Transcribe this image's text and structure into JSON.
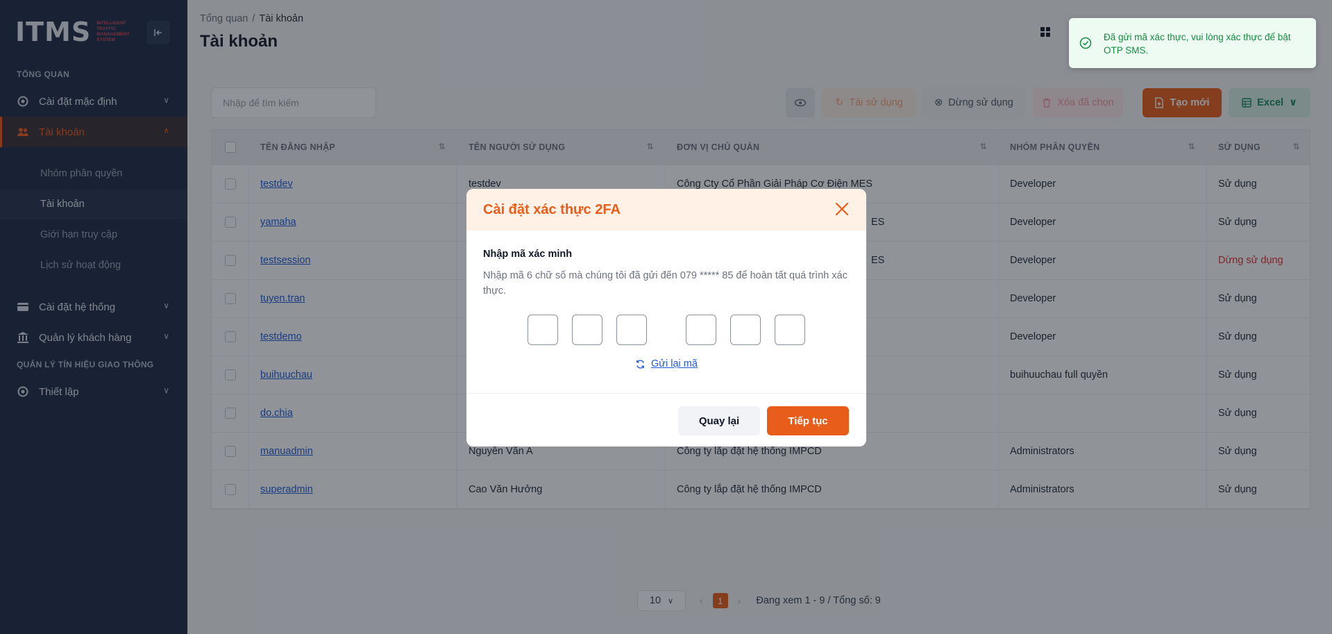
{
  "sidebar": {
    "logo_text": "ITMS",
    "logo_sub": "INTELLIGENT TRAFFIC MANAGEMENT SYSTEM",
    "section_overview": "TỔNG QUAN",
    "section_traffic": "QUẢN LÝ TÍN HIỆU GIAO THÔNG",
    "items": [
      {
        "label": "Cài đặt mặc định"
      },
      {
        "label": "Tài khoản"
      },
      {
        "label": "Cài đặt hệ thống"
      },
      {
        "label": "Quản lý khách hàng"
      },
      {
        "label": "Thiết lập"
      }
    ],
    "subitems": [
      {
        "label": "Nhóm phân quyền"
      },
      {
        "label": "Tài khoản"
      },
      {
        "label": "Giới hạn truy cập"
      },
      {
        "label": "Lịch sử hoạt động"
      }
    ]
  },
  "header": {
    "breadcrumb_root": "Tổng quan",
    "breadcrumb_sep": "/",
    "breadcrumb_current": "Tài khoản",
    "title": "Tài khoản"
  },
  "toolbar": {
    "search_placeholder": "Nhập để tìm kiếm",
    "reuse_label": "Tái sử dụng",
    "stop_label": "Dừng sử dụng",
    "delete_label": "Xóa đã chọn",
    "new_label": "Tạo mới",
    "excel_label": "Excel"
  },
  "table": {
    "headers": [
      "TÊN ĐĂNG NHẬP",
      "TÊN NGƯỜI SỬ DỤNG",
      "ĐƠN VỊ CHỦ QUẢN",
      "NHÓM PHÂN QUYỀN",
      "SỬ DỤNG"
    ],
    "rows": [
      {
        "username": "testdev",
        "name": "testdev",
        "unit": "Công Cty Cổ Phần Giải Pháp Cơ Điện MES",
        "group": "Developer",
        "status": "Sử dụng"
      },
      {
        "username": "yamaha",
        "name": "",
        "unit": "ES",
        "group": "Developer",
        "status": "Sử dụng"
      },
      {
        "username": "testsession",
        "name": "",
        "unit": "ES",
        "group": "Developer",
        "status": "Dừng sử dụng"
      },
      {
        "username": "tuyen.tran",
        "name": "",
        "unit": "",
        "group": "Developer",
        "status": "Sử dụng"
      },
      {
        "username": "testdemo",
        "name": "",
        "unit": "",
        "group": "Developer",
        "status": "Sử dụng"
      },
      {
        "username": "buihuuchau",
        "name": "",
        "unit": "",
        "group": "buihuuchau full quyền",
        "status": "Sử dụng"
      },
      {
        "username": "do.chia",
        "name": "",
        "unit": "",
        "group": "",
        "status": "Sử dụng"
      },
      {
        "username": "manuadmin",
        "name": "Nguyễn Văn A",
        "unit": "Công ty lắp đặt hệ thống IMPCD",
        "group": "Administrators",
        "status": "Sử dụng"
      },
      {
        "username": "superadmin",
        "name": "Cao Văn Hưởng",
        "unit": "Công ty lắp đặt hệ thống IMPCD",
        "group": "Administrators",
        "status": "Sử dụng"
      }
    ]
  },
  "pagination": {
    "page_size": "10",
    "current_page": "1",
    "info": "Đang xem 1 - 9 / Tổng số: 9"
  },
  "modal": {
    "title": "Cài đặt xác thực 2FA",
    "label": "Nhập mã xác minh",
    "description": "Nhập mã 6 chữ số mà chúng tôi đã gửi đến 079 ***** 85 để hoàn tất quá trình xác thực.",
    "resend_label": "Gửi lại mã",
    "back_label": "Quay lại",
    "next_label": "Tiếp tục",
    "otp": [
      "",
      "",
      "",
      "",
      "",
      ""
    ]
  },
  "toast": {
    "message": "Đã gửi mã xác thực, vui lòng xác thực để bật OTP SMS."
  },
  "colors": {
    "accent": "#e85d1a",
    "sidebar_bg": "#1e2a44",
    "success": "#168a3e",
    "danger": "#e0303a",
    "link": "#1f5ad8"
  }
}
